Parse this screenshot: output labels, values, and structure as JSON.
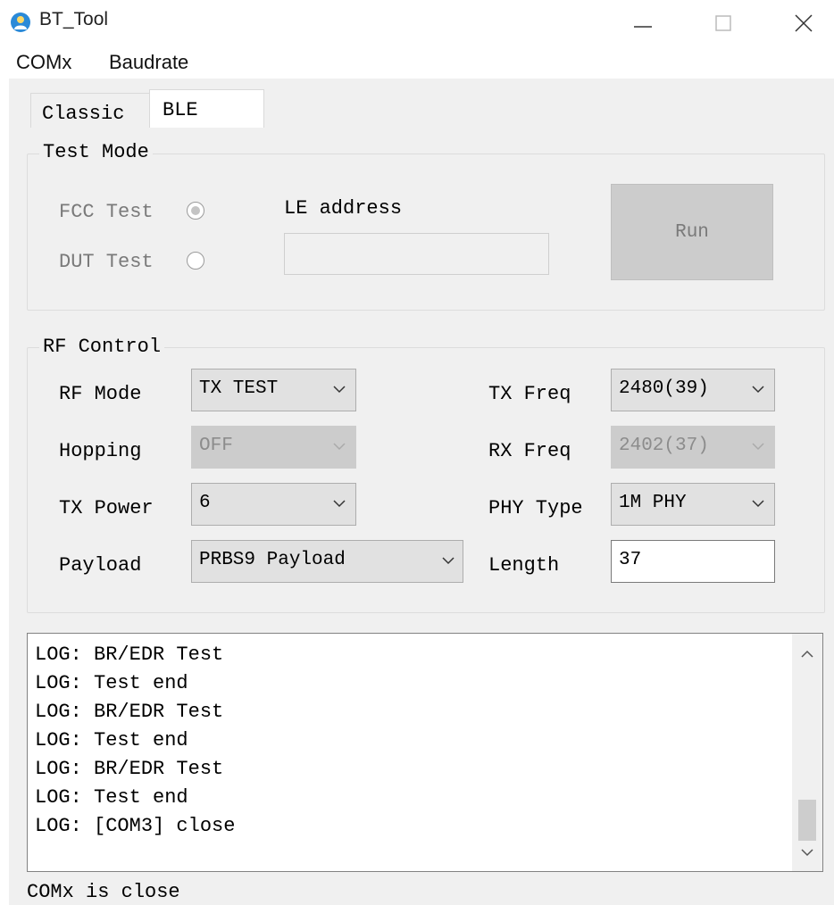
{
  "window": {
    "title": "BT_Tool"
  },
  "menu": {
    "items": [
      "COMx",
      "Baudrate"
    ]
  },
  "tabs": [
    {
      "label": "Classic",
      "active": false
    },
    {
      "label": "BLE",
      "active": true
    }
  ],
  "test_mode": {
    "title": "Test Mode",
    "fcc_label": "FCC Test",
    "dut_label": "DUT Test",
    "fcc_selected": true,
    "dut_selected": false,
    "le_address_label": "LE address",
    "le_address_value": "",
    "run_label": "Run"
  },
  "rf_control": {
    "title": "RF Control",
    "rf_mode": {
      "label": "RF Mode",
      "value": "TX TEST"
    },
    "hopping": {
      "label": "Hopping",
      "value": "OFF",
      "disabled": true
    },
    "tx_power": {
      "label": "TX Power",
      "value": "6"
    },
    "payload": {
      "label": "Payload",
      "value": "PRBS9 Payload"
    },
    "tx_freq": {
      "label": "TX Freq",
      "value": "2480(39)"
    },
    "rx_freq": {
      "label": "RX Freq",
      "value": "2402(37)",
      "disabled": true
    },
    "phy_type": {
      "label": "PHY Type",
      "value": "1M PHY"
    },
    "length": {
      "label": "Length",
      "value": "37"
    }
  },
  "log": {
    "lines": [
      "LOG: BR/EDR Test",
      "LOG: Test end",
      "LOG: BR/EDR Test",
      "LOG: Test end",
      "LOG: BR/EDR Test",
      "LOG: Test end",
      "LOG: [COM3] close"
    ]
  },
  "status": {
    "text": "COMx is close"
  },
  "icons": {
    "app": "app-person-icon",
    "minimize": "minimize-icon",
    "maximize": "maximize-icon",
    "close": "close-icon"
  },
  "colors": {
    "app_icon": "#2b8ad8",
    "panel_bg": "#f0f0f0",
    "disabled_text": "#7a7a7a"
  }
}
